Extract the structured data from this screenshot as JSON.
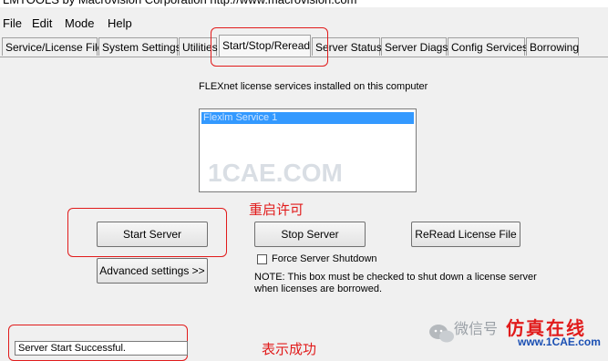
{
  "window": {
    "title": "LMTOOLS by Macrovision Corporation http://www.macrovision.com"
  },
  "menu": {
    "file": "File",
    "edit": "Edit",
    "mode": "Mode",
    "help": "Help"
  },
  "tabs": [
    {
      "label": "Service/License File"
    },
    {
      "label": "System Settings"
    },
    {
      "label": "Utilities"
    },
    {
      "label": "Start/Stop/Reread"
    },
    {
      "label": "Server Status"
    },
    {
      "label": "Server Diags"
    },
    {
      "label": "Config Services"
    },
    {
      "label": "Borrowing"
    }
  ],
  "panel": {
    "services_label": "FLEXnet license services installed on this computer",
    "services": [
      {
        "label": "Flexlm Service 1",
        "selected": true
      }
    ],
    "watermark": "1CAE.COM",
    "annotation_restart": "重启许可",
    "annotation_success": "表示成功",
    "start_server": "Start Server",
    "stop_server": "Stop Server",
    "reread": "ReRead License File",
    "advanced": "Advanced settings >>",
    "force_shutdown_label": "Force Server Shutdown",
    "force_shutdown_checked": false,
    "note": "NOTE:  This box must be checked to shut down a license server when licenses are borrowed.",
    "status_text": "Server Start Successful."
  },
  "corner_watermark": {
    "wechat": "微信号",
    "site_cn": "仿真在线",
    "site_url": "www.1CAE.com"
  },
  "colors": {
    "annotation_red": "#e11b1b",
    "selection_blue": "#3399ff"
  }
}
